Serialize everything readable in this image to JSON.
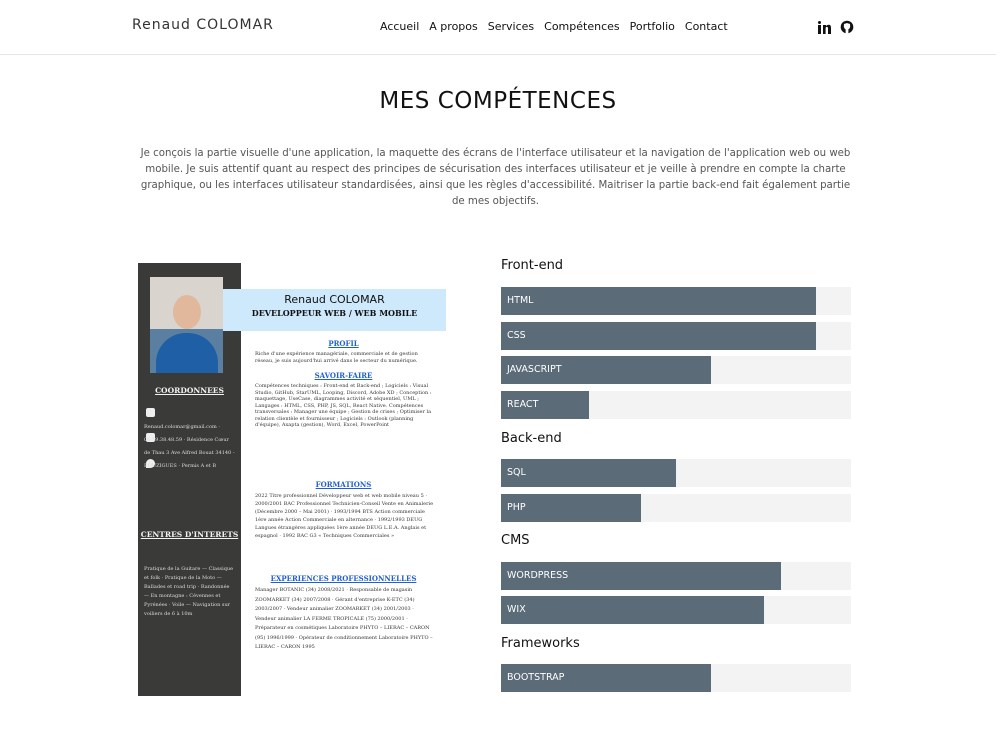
{
  "header": {
    "logo": "Renaud COLOMAR",
    "nav": [
      "Accueil",
      "A propos",
      "Services",
      "Compétences",
      "Portfolio",
      "Contact"
    ],
    "social_icons": [
      "linkedin-icon",
      "github-icon"
    ]
  },
  "main": {
    "title": "MES COMPÉTENCES",
    "intro": "Je conçois la partie visuelle d'une application, la maquette des écrans de l'interface utilisateur et la navigation de l'application web ou web mobile. Je suis attentif quant au respect des principes de sécurisation des interfaces utilisateur et je veille à prendre en compte la charte graphique, ou les interfaces utilisateur standardisées, ainsi que les règles d'accessibilité. Maitriser la partie back-end fait également partie de mes objectifs."
  },
  "cv": {
    "name": "Renaud COLOMAR",
    "role": "DEVELOPPEUR WEB / WEB MOBILE",
    "profil_h": "PROFIL",
    "profil_t": "Riche d'une expérience managériale, commerciale et de gestion réseau, je suis aujourd'hui arrivé dans le secteur du numérique.",
    "savoir_h": "SAVOIR-FAIRE",
    "savoir_t": "Compétences techniques : Front-end et Back-end ; Logiciels : Visual Studio, GitHub, StarUML, Looping, Discord, Adobe XD ; Conception : maquettage, UseCase, diagrammes activité et séquentiel, UML ; Langages : HTML, CSS, PHP, JS, SQL, React Native. Compétences transversales : Manager une équipe ; Gestion de crises ; Optimiser la relation clientèle et fournisseur ; Logiciels : Outlook (planning d'équipe), Axapta (gestion), Word, Excel, PowerPoint",
    "formations_h": "FORMATIONS",
    "formations_t": "2022 Titre professionnel Développeur web et web mobile niveau 5 · 2000/2001 BAC Professionnel Technicien-Conseil Vente en Animalerie (Décembre 2000 – Mai 2001) · 1993/1994 BTS Action commerciale 1ère année Action Commerciale en alternance · 1992/1993 DEUG Langues étrangères appliquées 1ère année DEUG L.E.A. Anglais et espagnol · 1992 BAC G3 « Techniques Commerciales »",
    "exp_h": "EXPERIENCES PROFESSIONNELLES",
    "exp_t": "Manager BOTANIC (34) 2008/2021 · Responsable de magasin ZOOMARKET (34) 2007/2008 · Gérant d'entreprise K-ETC (34) 2003/2007 · Vendeur animalier ZOOMARKET (34) 2001/2003 · Vendeur animalier LA FERME TROPICALE (75) 2000/2001 · Préparateur en cosmétiques Laboratoire PHYTO – LIERAC – CARON (95) 1996/1999 · Opérateur de conditionnement Laboratoire PHYTO – LIERAC – CARON 1995",
    "coord_h": "COORDONNEES",
    "coord_t": "Renaud.colomar@gmail.com · 06.59.38.48.59 · Résidence Cœur de Thau 3 Ave Alfred Bouat 34140 - BOUZIGUES · Permis A et B",
    "centres_h": "CENTRES D'INTERETS",
    "centres_t": "Pratique de la Guitare — Classique et folk · Pratique de la Moto — Ballades et road trip · Randonnée — En montagne : Cévennes et Pyrénées · Voile — Navigation sur voiliers de 6 à 10m"
  },
  "skills": [
    {
      "category": "Front-end",
      "items": [
        {
          "label": "HTML",
          "level": 90
        },
        {
          "label": "CSS",
          "level": 90
        },
        {
          "label": "JAVASCRIPT",
          "level": 60
        },
        {
          "label": "REACT",
          "level": 25
        }
      ]
    },
    {
      "category": "Back-end",
      "items": [
        {
          "label": "SQL",
          "level": 50
        },
        {
          "label": "PHP",
          "level": 40
        }
      ]
    },
    {
      "category": "CMS",
      "items": [
        {
          "label": "WORDPRESS",
          "level": 80
        },
        {
          "label": "WIX",
          "level": 75
        }
      ]
    },
    {
      "category": "Frameworks",
      "items": [
        {
          "label": "BOOTSTRAP",
          "level": 60
        }
      ]
    }
  ],
  "colors": {
    "bar_fill": "#5b6b78",
    "bar_track": "#f3f3f3",
    "cv_side": "#3a3a38",
    "cv_name_band": "#cde9fb"
  }
}
